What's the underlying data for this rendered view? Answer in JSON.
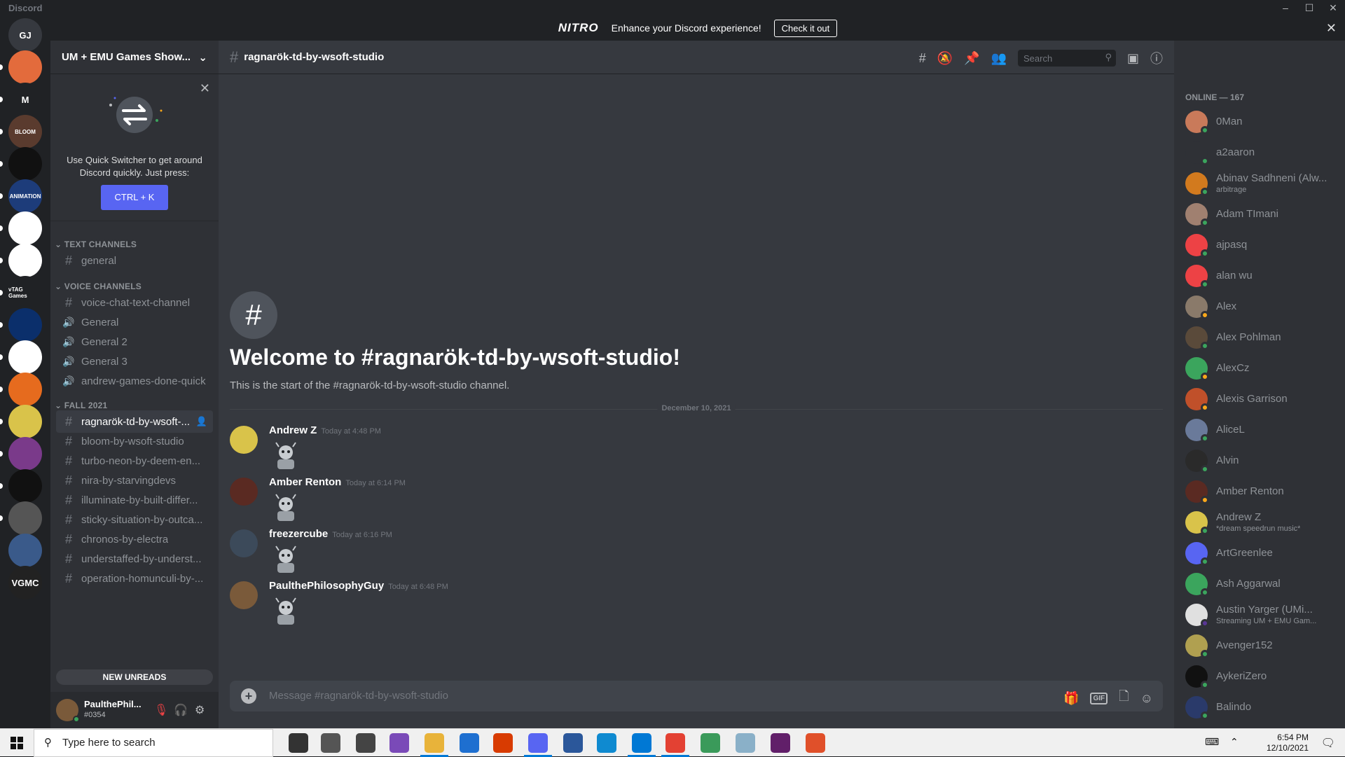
{
  "app": {
    "title": "Discord"
  },
  "nitro": {
    "logo": "NITRO",
    "message": "Enhance your Discord experience!",
    "cta": "Check it out"
  },
  "guilds": [
    {
      "label": "GJ",
      "color": "#36393f"
    },
    {
      "label": "",
      "color": "#e36b3c"
    },
    {
      "label": "M",
      "color": "#202225"
    },
    {
      "label": "BLOOM",
      "color": "#5a3b2e"
    },
    {
      "label": "",
      "color": "#111111"
    },
    {
      "label": "ANIMATION",
      "color": "#1d3c7a"
    },
    {
      "label": "",
      "color": "#ffffff"
    },
    {
      "label": "",
      "color": "#ffffff"
    },
    {
      "label": "vTAG Games",
      "color": "#202225"
    },
    {
      "label": "",
      "color": "#0b2f6b"
    },
    {
      "label": "",
      "color": "#ffffff"
    },
    {
      "label": "",
      "color": "#e66b1e"
    },
    {
      "label": "",
      "color": "#d9c34a"
    },
    {
      "label": "",
      "color": "#7a3a8a"
    },
    {
      "label": "",
      "color": "#111111"
    },
    {
      "label": "",
      "color": "#555555"
    },
    {
      "label": "",
      "color": "#3a5a8a"
    },
    {
      "label": "VGMC",
      "color": "#222222"
    }
  ],
  "server": {
    "name": "UM + EMU Games Show...",
    "quick_switcher": {
      "text": "Use Quick Switcher to get around Discord quickly. Just press:",
      "shortcut": "CTRL + K"
    },
    "categories": {
      "text": "TEXT CHANNELS",
      "voice": "VOICE CHANNELS",
      "fall": "FALL 2021"
    },
    "text_channels": [
      "general"
    ],
    "voice_channels": [
      {
        "name": "voice-chat-text-channel",
        "type": "text"
      },
      {
        "name": "General",
        "type": "voice"
      },
      {
        "name": "General 2",
        "type": "voice"
      },
      {
        "name": "General 3",
        "type": "voice"
      },
      {
        "name": "andrew-games-done-quick",
        "type": "voice"
      }
    ],
    "fall_channels": [
      "ragnarök-td-by-wsoft-...",
      "bloom-by-wsoft-studio",
      "turbo-neon-by-deem-en...",
      "nira-by-starvingdevs",
      "illuminate-by-built-differ...",
      "sticky-situation-by-outca...",
      "chronos-by-electra",
      "understaffed-by-underst...",
      "operation-homunculi-by-..."
    ],
    "new_unreads": "NEW UNREADS"
  },
  "user": {
    "name": "PaulthePhil...",
    "tag": "#0354"
  },
  "channel": {
    "name": "ragnarök-td-by-wsoft-studio",
    "search_placeholder": "Search",
    "welcome_title": "Welcome to #ragnarök-td-by-wsoft-studio!",
    "welcome_sub": "This is the start of the #ragnarök-td-by-wsoft-studio channel.",
    "date_divider": "December 10, 2021",
    "composer_placeholder": "Message #ragnarök-td-by-wsoft-studio",
    "gif_label": "GIF"
  },
  "messages": [
    {
      "author": "Andrew Z",
      "time": "Today at 4:48 PM",
      "avatar_color": "#d9c34a"
    },
    {
      "author": "Amber Renton",
      "time": "Today at 6:14 PM",
      "avatar_color": "#5a2a22"
    },
    {
      "author": "freezercube",
      "time": "Today at 6:16 PM",
      "avatar_color": "#3c4a5a"
    },
    {
      "author": "PaulthePhilosophyGuy",
      "time": "Today at 6:48 PM",
      "avatar_color": "#7a5a3a"
    }
  ],
  "members": {
    "header": "ONLINE — 167",
    "list": [
      {
        "name": "0Man",
        "sub": "",
        "color": "#c97a5a",
        "status": "#3ba55d"
      },
      {
        "name": "a2aaron",
        "sub": "",
        "color": "#2f3136",
        "status": "#3ba55d"
      },
      {
        "name": "Abinav Sadhneni (Alw...",
        "sub": "arbitrage",
        "color": "#d27a1e",
        "status": "#3ba55d"
      },
      {
        "name": "Adam TImani",
        "sub": "",
        "color": "#a08070",
        "status": "#3ba55d"
      },
      {
        "name": "ajpasq",
        "sub": "",
        "color": "#ed4245",
        "status": "#3ba55d"
      },
      {
        "name": "alan wu",
        "sub": "",
        "color": "#ed4245",
        "status": "#3ba55d"
      },
      {
        "name": "Alex",
        "sub": "",
        "color": "#8a7a6a",
        "status": "#faa81a"
      },
      {
        "name": "Alex Pohlman",
        "sub": "",
        "color": "#5a4a3a",
        "status": "#3ba55d"
      },
      {
        "name": "AlexCz",
        "sub": "",
        "color": "#3ba55d",
        "status": "#faa81a"
      },
      {
        "name": "Alexis Garrison",
        "sub": "",
        "color": "#c0502a",
        "status": "#faa81a"
      },
      {
        "name": "AliceL",
        "sub": "",
        "color": "#6a7a9a",
        "status": "#3ba55d"
      },
      {
        "name": "Alvin",
        "sub": "",
        "color": "#2a2a2a",
        "status": "#3ba55d"
      },
      {
        "name": "Amber Renton",
        "sub": "",
        "color": "#5a2a22",
        "status": "#faa81a"
      },
      {
        "name": "Andrew Z",
        "sub": "*dream speedrun music*",
        "color": "#d9c34a",
        "status": "#3ba55d"
      },
      {
        "name": "ArtGreenlee",
        "sub": "",
        "color": "#5865f2",
        "status": "#3ba55d"
      },
      {
        "name": "Ash Aggarwal",
        "sub": "",
        "color": "#3ba55d",
        "status": "#3ba55d"
      },
      {
        "name": "Austin Yarger (UMi...",
        "sub": "Streaming UM + EMU Gam...",
        "color": "#e0e0e0",
        "status": "#593695"
      },
      {
        "name": "Avenger152",
        "sub": "",
        "color": "#b0a050",
        "status": "#3ba55d"
      },
      {
        "name": "AykeriZero",
        "sub": "",
        "color": "#111111",
        "status": "#3ba55d"
      },
      {
        "name": "Balindo",
        "sub": "",
        "color": "#2a3a6a",
        "status": "#3ba55d"
      }
    ]
  },
  "taskbar": {
    "search_placeholder": "Type here to search",
    "time": "6:54 PM",
    "date": "12/10/2021"
  }
}
